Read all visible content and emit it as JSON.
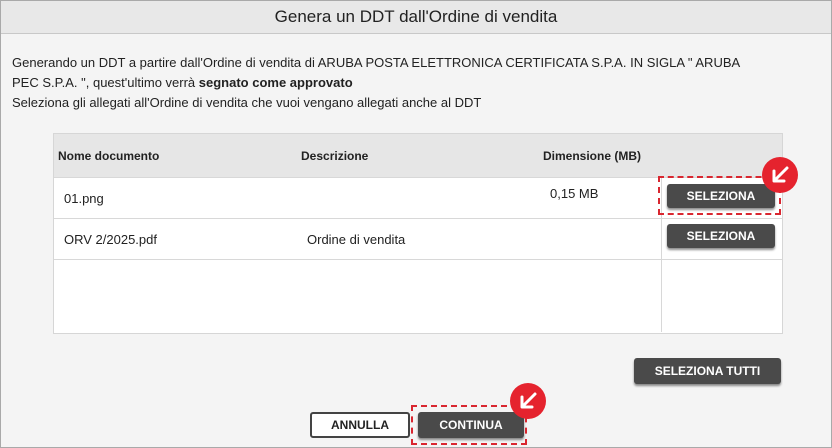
{
  "dialog": {
    "title": "Genera un DDT dall'Ordine di vendita",
    "intro_line1": "Generando un DDT a partire dall'Ordine di vendita di ARUBA POSTA ELETTRONICA CERTIFICATA S.P.A. IN SIGLA \" ARUBA",
    "intro_line2_prefix": "PEC S.P.A. \", quest'ultimo verrà ",
    "intro_line2_bold": "segnato come approvato",
    "intro_line3": "Seleziona gli allegati all'Ordine di vendita che vuoi vengano allegati anche al DDT"
  },
  "table": {
    "columns": [
      "Nome documento",
      "Descrizione",
      "Dimensione (MB)"
    ],
    "rows": [
      {
        "name": "01.png",
        "description": "",
        "size": "0,15 MB",
        "button": "SELEZIONA"
      },
      {
        "name": "ORV 2/2025.pdf",
        "description": "Ordine di vendita",
        "size": "",
        "button": "SELEZIONA"
      }
    ]
  },
  "actions": {
    "select_all": "SELEZIONA TUTTI",
    "cancel": "ANNULLA",
    "continue": "CONTINUA"
  },
  "colors": {
    "highlight": "#d9262f",
    "button_dark": "#4a4a4a",
    "pointer": "#e5232e"
  },
  "icons": {
    "pointer": "arrow-down-left-icon"
  }
}
